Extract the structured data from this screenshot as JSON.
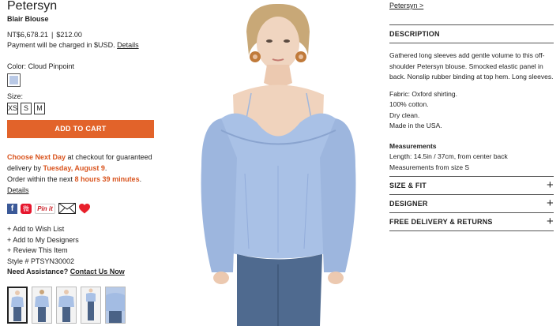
{
  "product": {
    "brand": "Petersyn",
    "name": "Blair Blouse",
    "price_twd": "NT$6,678.21",
    "price_sep": "|",
    "price_usd": "$212.00",
    "payment_note": "Payment will be charged in $USD.",
    "details_link": "Details"
  },
  "options": {
    "color_label": "Color: Cloud Pinpoint",
    "swatch_color": "#b9c9e6",
    "size_label": "Size:",
    "sizes": [
      "XS",
      "S",
      "M"
    ]
  },
  "cart": {
    "label": "ADD TO CART",
    "color": "#e2632a"
  },
  "delivery": {
    "choose": "Choose Next Day",
    "text1": " at checkout for guaranteed",
    "text2": "delivery by ",
    "date": "Tuesday, August 9",
    "period": ".",
    "order_prefix": "Order within the next ",
    "countdown": "8 hours 39 minutes",
    "order_suffix": ". ",
    "details_link": "Details"
  },
  "share": {
    "facebook": "f",
    "weibo": "微",
    "pinterest": "Pin it"
  },
  "actions": {
    "wishlist": "+ Add to Wish List",
    "designers": "+ Add to My Designers",
    "review": "+ Review This Item",
    "style": "Style # PTSYN30002",
    "need": "Need Assistance?",
    "contact": "Contact Us Now"
  },
  "thumbnails": [
    "front",
    "back",
    "side",
    "full",
    "detail"
  ],
  "breadcrumb": "Petersyn >",
  "description": {
    "heading": "DESCRIPTION",
    "body": "Gathered long sleeves add gentle volume to this off-shoulder Petersyn blouse. Smocked elastic panel in back. Nonslip rubber binding at top hem. Long sleeves.",
    "fabric": [
      "Fabric: Oxford shirting.",
      "100% cotton.",
      "Dry clean.",
      "Made in the USA."
    ],
    "measurements_title": "Measurements",
    "measurements": [
      "Length: 14.5in / 37cm, from center back",
      "Measurements from size S"
    ]
  },
  "sections": [
    {
      "label": "SIZE & FIT",
      "icon": "plus"
    },
    {
      "label": "DESIGNER",
      "icon": "plus"
    },
    {
      "label": "FREE DELIVERY & RETURNS",
      "icon": "plus"
    }
  ]
}
